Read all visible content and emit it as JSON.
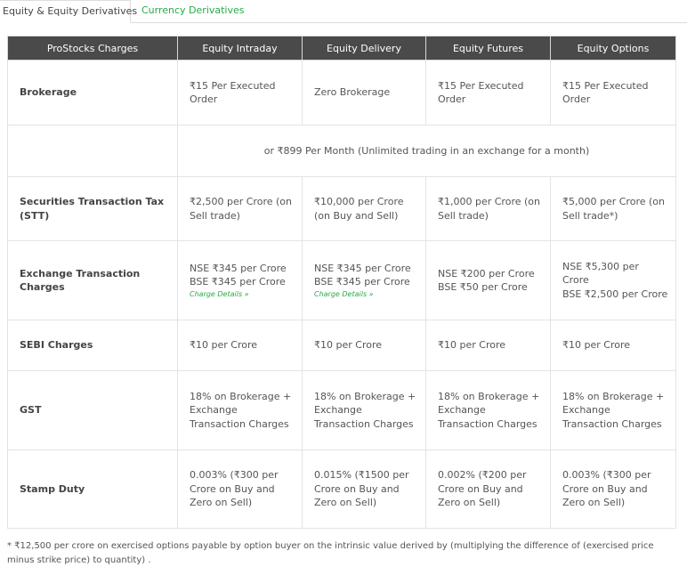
{
  "tabs": [
    {
      "label": "Equity & Equity Derivatives"
    },
    {
      "label": "Currency Derivatives"
    }
  ],
  "table": {
    "headers": [
      "ProStocks Charges",
      "Equity Intraday",
      "Equity Delivery",
      "Equity Futures",
      "Equity Options"
    ],
    "brokerage": {
      "label": "Brokerage",
      "values": [
        "₹15 Per Executed Order",
        "Zero Brokerage",
        "₹15 Per Executed Order",
        "₹15 Per Executed Order"
      ]
    },
    "monthly_plan": "or ₹899 Per Month (Unlimited trading in an exchange for a month)",
    "stt": {
      "label": "Securities Transaction Tax (STT)",
      "values": [
        "₹2,500 per Crore (on Sell trade)",
        "₹10,000 per Crore (on Buy and Sell)",
        "₹1,000 per Crore (on Sell trade)",
        "₹5,000 per Crore (on Sell trade*)"
      ]
    },
    "exchange": {
      "label": "Exchange Transaction Charges",
      "nse": [
        "NSE ₹345 per Crore",
        "NSE ₹345 per Crore",
        "NSE ₹200 per Crore",
        "NSE ₹5,300 per Crore"
      ],
      "bse": [
        "BSE ₹345 per Crore",
        "BSE ₹345 per Crore",
        "BSE ₹50 per Crore",
        "BSE ₹2,500 per Crore"
      ],
      "link_label": "Charge Details »"
    },
    "sebi": {
      "label": "SEBI Charges",
      "values": [
        "₹10 per Crore",
        "₹10 per Crore",
        "₹10 per Crore",
        "₹10 per Crore"
      ]
    },
    "gst": {
      "label": "GST",
      "values": [
        "18% on Brokerage + Exchange Transaction Charges",
        "18% on Brokerage + Exchange Transaction Charges",
        "18% on Brokerage + Exchange Transaction Charges",
        "18% on Brokerage + Exchange Transaction Charges"
      ]
    },
    "stamp": {
      "label": "Stamp Duty",
      "values": [
        "0.003% (₹300 per Crore on Buy and Zero on Sell)",
        "0.015% (₹1500 per Crore on Buy and Zero on Sell)",
        "0.002% (₹200 per Crore on Buy and Zero on Sell)",
        "0.003% (₹300 per Crore on Buy and Zero on Sell)"
      ]
    }
  },
  "footnote": "* ₹12,500 per crore on exercised options payable by option buyer on the intrinsic value derived by (multiplying the difference of (exercised price minus strike price) to quantity) ."
}
